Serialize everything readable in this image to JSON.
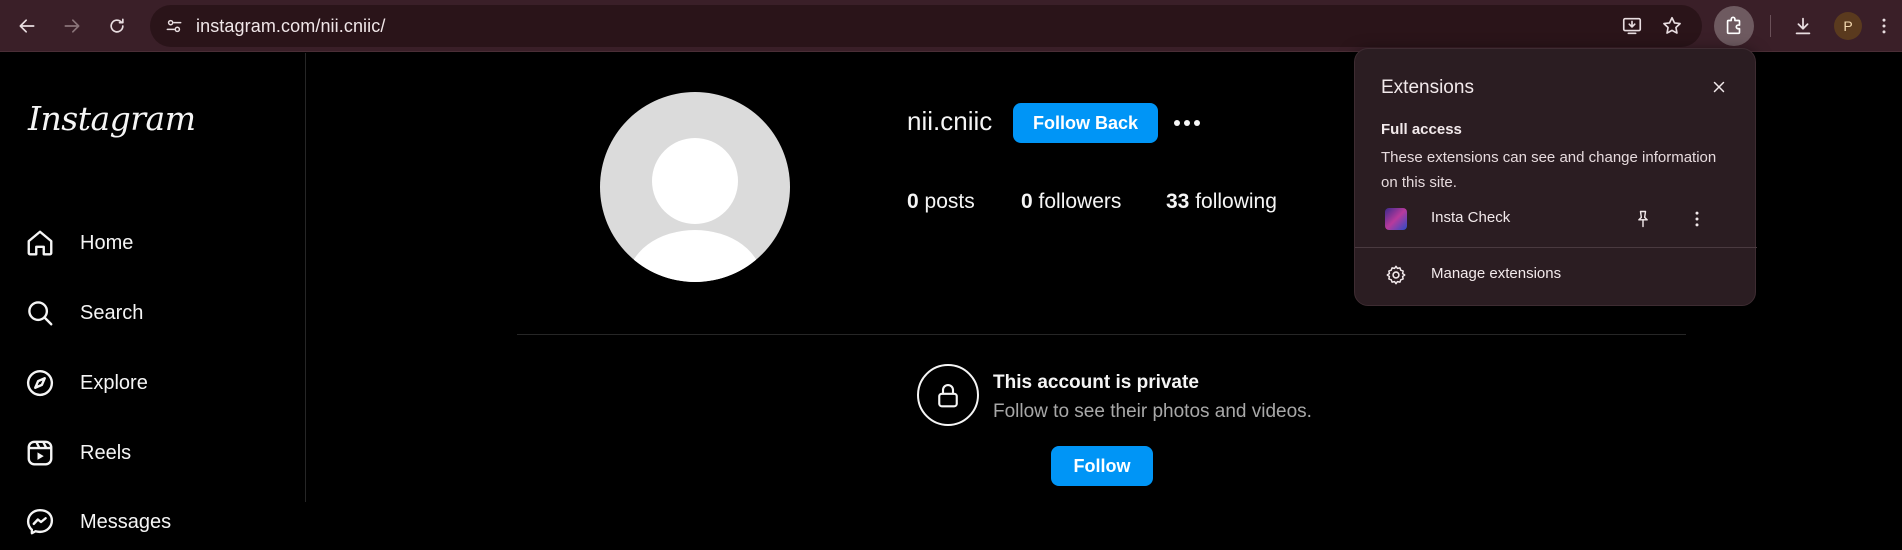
{
  "browser": {
    "url": "instagram.com/nii.cniic/",
    "profile_initial": "P",
    "icons": {
      "back": "arrow-left-icon",
      "forward": "arrow-right-icon",
      "reload": "reload-icon",
      "site_info": "tune-icon",
      "install": "install-app-icon",
      "bookmark": "star-icon",
      "extensions": "puzzle-icon",
      "downloads": "download-icon",
      "menu": "kebab-icon"
    }
  },
  "sidebar": {
    "logo": "Instagram",
    "items": [
      {
        "label": "Home",
        "icon": "home-icon"
      },
      {
        "label": "Search",
        "icon": "search-icon"
      },
      {
        "label": "Explore",
        "icon": "compass-icon"
      },
      {
        "label": "Reels",
        "icon": "reels-icon"
      },
      {
        "label": "Messages",
        "icon": "messenger-icon"
      }
    ]
  },
  "profile": {
    "username": "nii.cniic",
    "follow_back_label": "Follow Back",
    "stats": {
      "posts_count": "0",
      "posts_label": " posts",
      "followers_count": "0",
      "followers_label": " followers",
      "following_count": "33",
      "following_label": " following"
    },
    "private_title": "This account is private",
    "private_subtitle": "Follow to see their photos and videos.",
    "follow_label": "Follow"
  },
  "extensions_popup": {
    "title": "Extensions",
    "section_title": "Full access",
    "section_desc": "These extensions can see and change information on this site.",
    "items": [
      {
        "name": "Insta Check"
      }
    ],
    "manage_label": "Manage extensions"
  },
  "colors": {
    "chrome_bg": "#3a1f28",
    "primary_button": "#0095f6",
    "popup_bg": "#2b1d22"
  }
}
